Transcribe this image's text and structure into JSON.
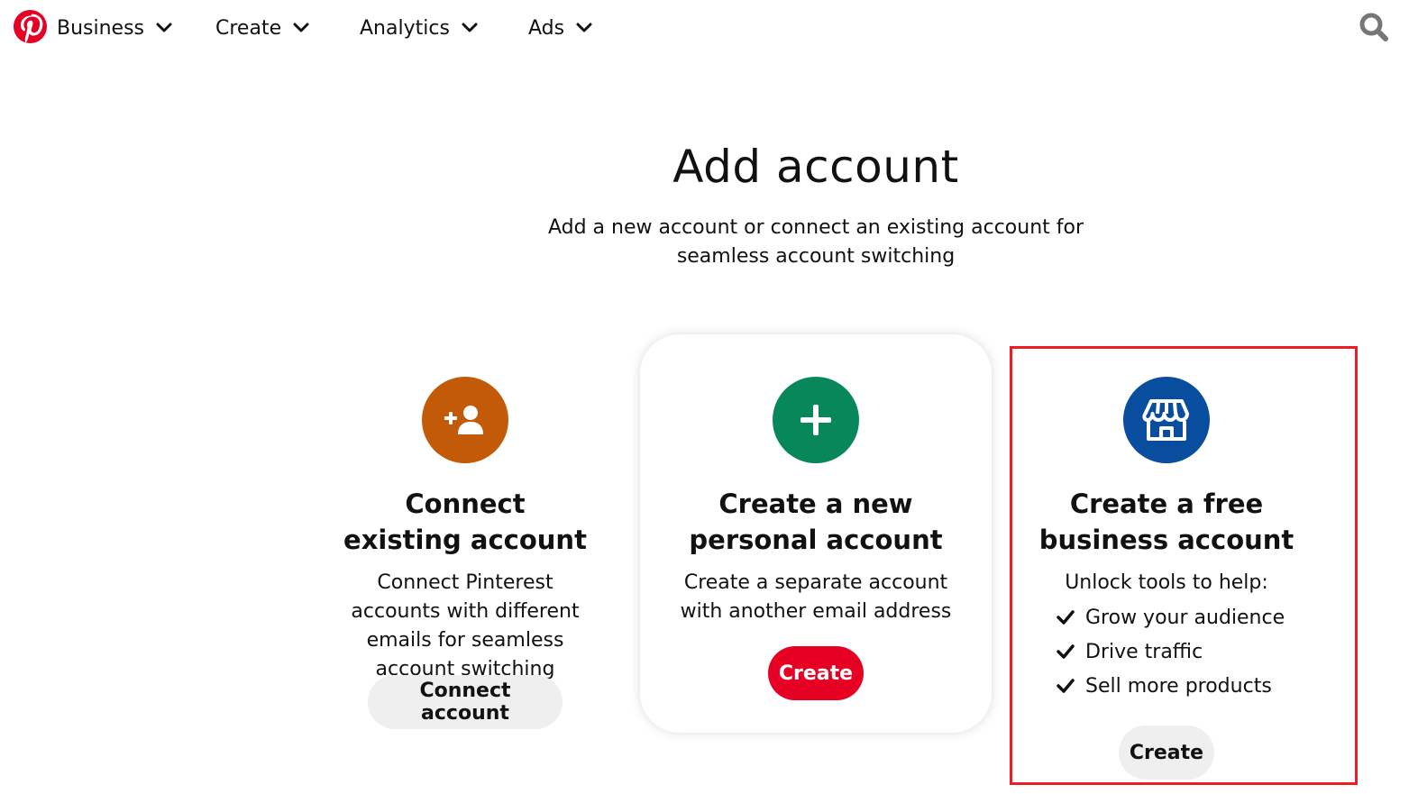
{
  "nav": {
    "items": [
      {
        "label": "Business"
      },
      {
        "label": "Create"
      },
      {
        "label": "Analytics"
      },
      {
        "label": "Ads"
      }
    ],
    "search_icon": "search-icon",
    "logo_icon": "pinterest-logo"
  },
  "header": {
    "title": "Add account",
    "subtitle": "Add a new account or connect an existing account for seamless account switching"
  },
  "cards": [
    {
      "icon": "add-person-icon",
      "icon_color": "#c35a07",
      "title": "Connect existing account",
      "description": "Connect Pinterest accounts with different emails for seamless account switching",
      "button_label": "Connect account"
    },
    {
      "icon": "plus-icon",
      "icon_color": "#08875a",
      "title": "Create a new personal account",
      "description": "Create a separate account with another email address",
      "button_label": "Create"
    },
    {
      "icon": "storefront-icon",
      "icon_color": "#084d9e",
      "title": "Create a free business account",
      "description": "Unlock tools to help:",
      "benefits": [
        "Grow your audience",
        "Drive traffic",
        "Sell more products"
      ],
      "button_label": "Create"
    }
  ],
  "colors": {
    "brand_red": "#e60023",
    "highlight_box": "#ee1c25"
  }
}
